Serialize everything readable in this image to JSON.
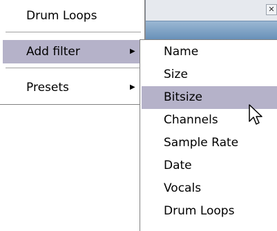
{
  "main_menu": {
    "items": [
      {
        "label": "Drum Loops",
        "has_submenu": false,
        "highlighted": false
      },
      {
        "label": "Add filter",
        "has_submenu": true,
        "highlighted": true
      },
      {
        "label": "Presets",
        "has_submenu": true,
        "highlighted": false
      }
    ],
    "submenu_arrow_icon": "triangle-right-icon"
  },
  "submenu": {
    "items": [
      {
        "label": "Name",
        "highlighted": false
      },
      {
        "label": "Size",
        "highlighted": false
      },
      {
        "label": "Bitsize",
        "highlighted": true
      },
      {
        "label": "Channels",
        "highlighted": false
      },
      {
        "label": "Sample Rate",
        "highlighted": false
      },
      {
        "label": "Date",
        "highlighted": false
      },
      {
        "label": "Vocals",
        "highlighted": false
      },
      {
        "label": "Drum Loops",
        "highlighted": false
      }
    ]
  },
  "colors": {
    "highlight": "#b5b2c9",
    "menu_background": "#ffffff",
    "title_bar": "#5d88b3"
  },
  "icons": {
    "close": "close-icon",
    "cursor": "mouse-pointer-icon"
  }
}
